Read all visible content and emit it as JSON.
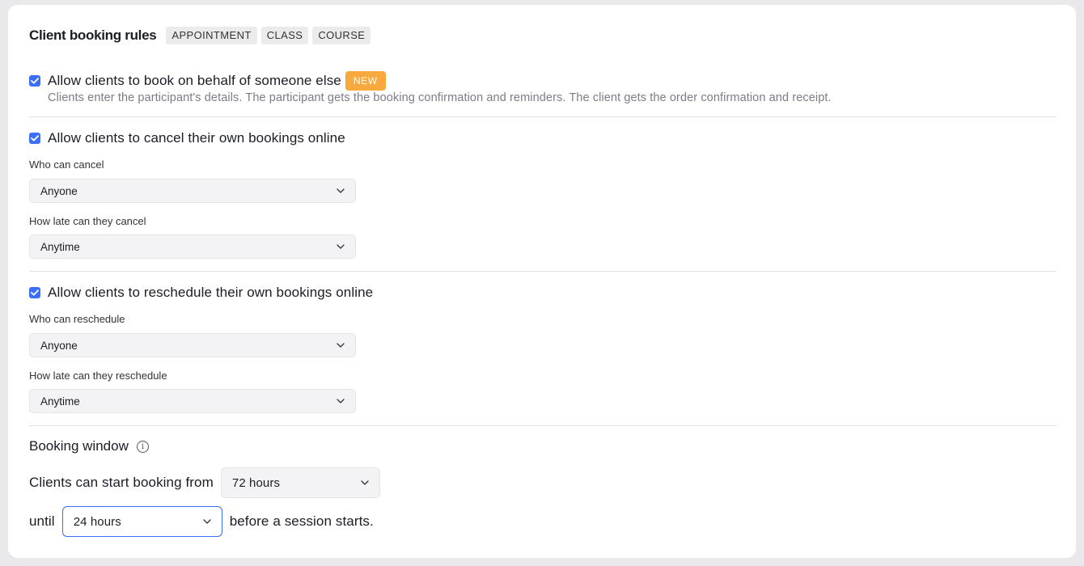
{
  "header": {
    "title": "Client booking rules",
    "tags": [
      "APPOINTMENT",
      "CLASS",
      "COURSE"
    ]
  },
  "behalf": {
    "label": "Allow clients to book on behalf of someone else",
    "badge": "NEW",
    "checked": true,
    "description": "Clients enter the participant's details. The participant gets the booking confirmation and reminders. The client gets the order confirmation and receipt."
  },
  "cancel": {
    "label": "Allow clients to cancel their own bookings online",
    "checked": true,
    "who_label": "Who can cancel",
    "who_value": "Anyone",
    "late_label": "How late can they cancel",
    "late_value": "Anytime"
  },
  "reschedule": {
    "label": "Allow clients to reschedule their own bookings online",
    "checked": true,
    "who_label": "Who can reschedule",
    "who_value": "Anyone",
    "late_label": "How late can they reschedule",
    "late_value": "Anytime"
  },
  "booking_window": {
    "title": "Booking window",
    "start_text": "Clients can start booking from",
    "start_value": "72 hours",
    "until_text": "until",
    "until_value": "24 hours",
    "end_text": "before a session starts."
  },
  "colors": {
    "accent": "#3b6ff5",
    "badge": "#f7a93e"
  },
  "icons": {
    "checkbox": "check-icon",
    "dropdown": "chevron-down-icon",
    "info": "info-icon"
  }
}
